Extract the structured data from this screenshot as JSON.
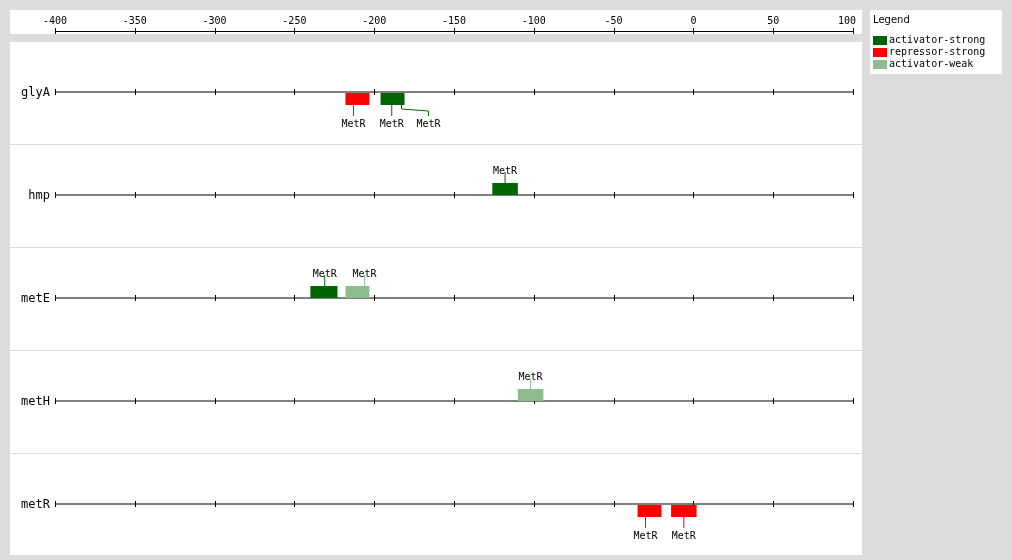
{
  "axis": {
    "ticks": [
      "-400",
      "-350",
      "-300",
      "-250",
      "-200",
      "-150",
      "-100",
      "-50",
      "0",
      "50",
      "100"
    ]
  },
  "tracks": [
    {
      "gene": "glyA",
      "sites": [
        {
          "label": "MetR",
          "color": "#ff0000"
        },
        {
          "label": "MetR",
          "color": "#006400"
        },
        {
          "label": "MetR"
        }
      ]
    },
    {
      "gene": "hmp",
      "sites": [
        {
          "label": "MetR",
          "color": "#006400"
        }
      ]
    },
    {
      "gene": "metE",
      "sites": [
        {
          "label": "MetR",
          "color": "#006400"
        },
        {
          "label": "MetR",
          "color": "#8fbc8f"
        }
      ]
    },
    {
      "gene": "metH",
      "sites": [
        {
          "label": "MetR",
          "color": "#8fbc8f"
        }
      ]
    },
    {
      "gene": "metR",
      "sites": [
        {
          "label": "MetR",
          "color": "#ff0000"
        },
        {
          "label": "MetR",
          "color": "#ff0000"
        }
      ]
    }
  ],
  "legend": {
    "title": "Legend",
    "items": [
      {
        "label": "activator-strong",
        "color": "#006400"
      },
      {
        "label": "repressor-strong",
        "color": "#ff0000"
      },
      {
        "label": "activator-weak",
        "color": "#8fbc8f"
      }
    ]
  }
}
